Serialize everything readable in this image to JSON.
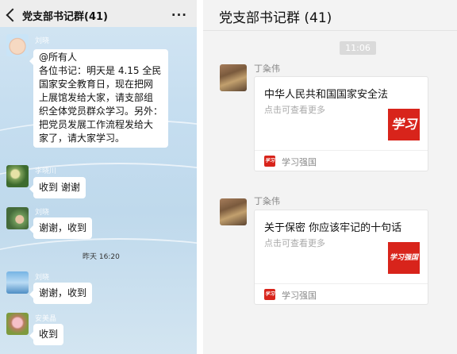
{
  "left_chat": {
    "title": "党支部书记群(41)",
    "messages": [
      {
        "sender": "刘晓",
        "lines": [
          "@所有人",
          "各位书记：明天是 4.15 全民",
          "国家安全教育日，现在把网",
          "上展馆发给大家，请支部组",
          "织全体党员群众学习。另外：",
          "把党员发展工作流程发给大",
          "家了，请大家学习。"
        ]
      },
      {
        "sender": "李晓川",
        "lines": [
          "收到  谢谢"
        ]
      },
      {
        "sender": "刘晓",
        "lines": [
          "谢谢，收到"
        ]
      },
      {
        "sender": "刘晓",
        "lines": [
          "谢谢，收到"
        ]
      },
      {
        "sender": "安美晶",
        "lines": [
          "收到"
        ]
      }
    ],
    "time_divider": "昨天 16:20"
  },
  "right_chat": {
    "title": "党支部书记群 (41)",
    "time": "11:06",
    "cards": [
      {
        "sender": "丁粂伟",
        "title": "中华人民共和国国家安全法",
        "desc": "点击可查看更多",
        "thumb_text": "学习",
        "source_icon_text": "学习",
        "source": "学习强国"
      },
      {
        "sender": "丁粂伟",
        "title": "关于保密 你应该牢记的十句话",
        "desc": "点击可查看更多",
        "thumb_text": "学习强国",
        "source_icon_text": "学习",
        "source": "学习强国"
      }
    ]
  },
  "colors": {
    "brand_red": "#d8241b",
    "chat_bg": "#c6def0",
    "right_bg": "#f3f3f3"
  }
}
